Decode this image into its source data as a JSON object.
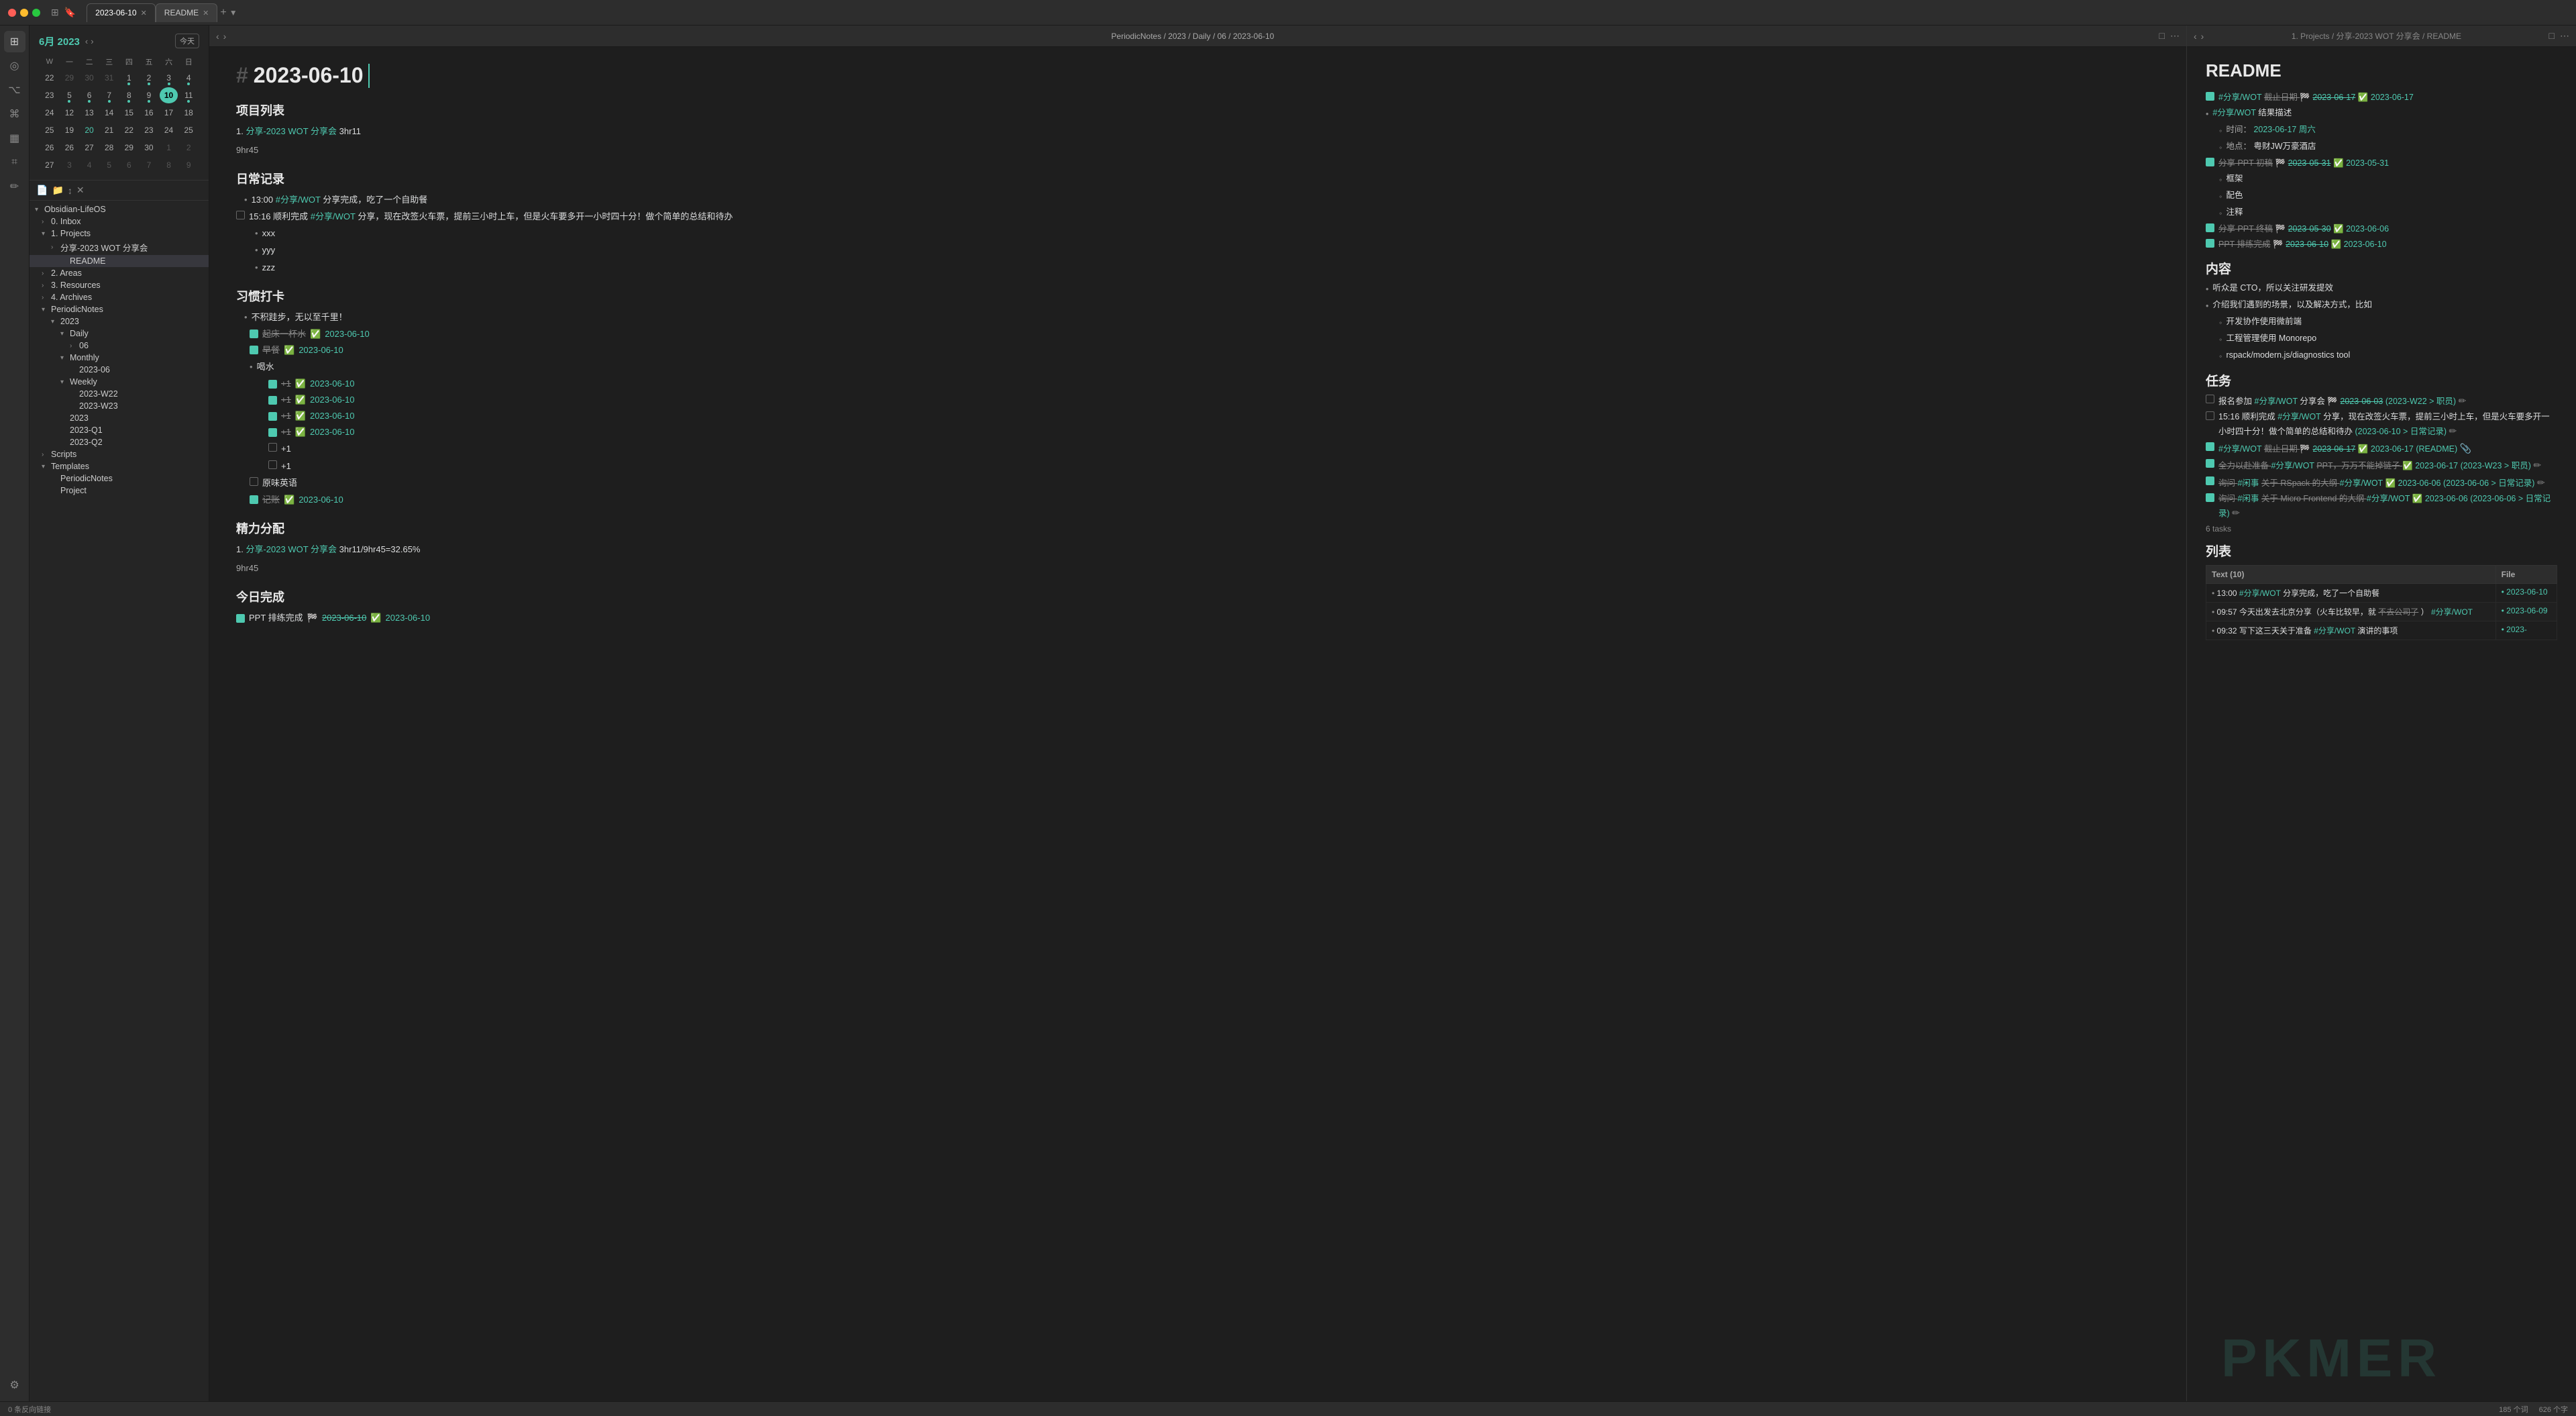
{
  "titlebar": {
    "tab1_label": "2023-06-10",
    "tab2_label": "README",
    "add_tab_label": "+",
    "tab1_active": true
  },
  "editor": {
    "breadcrumb": "PeriodicNotes / 2023 / Daily / 06 / 2023-06-10",
    "title_hash": "#",
    "title_text": "2023-06-10",
    "section1": "项目列表",
    "section2": "日常记录",
    "section3": "习惯打卡",
    "section4": "精力分配",
    "section5": "今日完成",
    "project_item1": "分享-2023 WOT 分享会",
    "project_time1": "3hr11",
    "project_subtotal": "9hr45",
    "daily_time1": "13:00",
    "daily_tag1": "#分享/WOT",
    "daily_text1": "分享完成，吃了一个自助餐",
    "daily_item2_prefix": "15:16 顺利完成",
    "daily_tag2": "#分享/WOT",
    "daily_text2": "分享，现在改签火车票，提前三小时上车，但是火车要多开一小时四十分！做个简单的总结和待办",
    "sub1": "xxx",
    "sub2": "yyy",
    "sub3": "zzz",
    "habit_intro": "不积跬步，无以至千里！",
    "habit1": "起床一杯水",
    "habit1_date": "2023-06-10",
    "habit2": "早餐",
    "habit2_date": "2023-06-10",
    "habit3": "喝水",
    "habit3_sub1_val": "+1",
    "habit3_sub1_date": "2023-06-10",
    "habit3_sub2_val": "+1",
    "habit3_sub2_date": "2023-06-10",
    "habit3_sub3_val": "+1",
    "habit3_sub3_date": "2023-06-10",
    "habit3_sub4_val": "+1",
    "habit3_sub4_date": "2023-06-10",
    "habit3_sub5_val": "+1",
    "habit3_sub6_val": "+1",
    "habit4": "原味英语",
    "habit5": "记账",
    "habit5_date": "2023-06-10",
    "energy_item1": "分享-2023 WOT 分享会",
    "energy_time1": "3hr11/9hr45=32.65%",
    "energy_subtotal": "9hr45",
    "done_item1": "PPT 排练完成",
    "done_date1": "2023-06-10",
    "done_date2": "2023-06-10"
  },
  "readme": {
    "breadcrumb": "1. Projects / 分享-2023 WOT 分享会 / README",
    "title": "README",
    "section_top_tag": "#分享/WOT",
    "section_top_strikethrough": "截止日期",
    "section_top_date1": "2023-06-17",
    "section_top_date2": "2023-06-17",
    "result_label": "#分享/WOT 结果描述",
    "time_label": "时间：",
    "time_val": "2023-06-17 周六",
    "place_label": "地点：",
    "place_val": "粤财JW万豪酒店",
    "ppt_draft": "分享 PPT 初稿",
    "ppt_draft_date1": "2023-05-31",
    "ppt_draft_date2": "2023-05-31",
    "ppt_sub1": "框架",
    "ppt_sub2": "配色",
    "ppt_sub3": "注释",
    "ppt_final": "分享 PPT 终稿",
    "ppt_final_date1": "2023-05-30",
    "ppt_final_date2": "2023-06-06",
    "ppt_done": "PPT 排练完成",
    "ppt_done_date1": "2023-06-10",
    "ppt_done_date2": "2023-06-10",
    "section_content": "内容",
    "content_item1": "听众是 CTO，所以关注研发提效",
    "content_item2": "介绍我们遇到的场景，以及解决方式，比如",
    "content_sub1": "开发协作使用微前端",
    "content_sub2": "工程管理使用 Monorepo",
    "content_sub3": "rspack/modern.js/diagnostics tool",
    "section_task": "任务",
    "task1_text": "报名参加",
    "task1_tag": "#分享/WOT",
    "task1_extra": "分享会",
    "task1_date": "2023-06-03",
    "task1_link": "2023-W22 > 职员",
    "task2_text": "15:16 顺利完成",
    "task2_tag": "#分享/WOT",
    "task2_body": "分享，现在改签火车票，提前三小时上车，但是火车要多开一小时四十分！做个简单的总结和待办",
    "task2_link": "2023-06-10 > 日常记录",
    "task3_tag": "#分享/WOT",
    "task3_text": "截止日期",
    "task3_date": "2023-06-17",
    "task3_link": "README",
    "task4_text": "全力以赴准备",
    "task4_tag": "#分享/WOT",
    "task4_body": "PPT，万万不能掉链子",
    "task4_date": "2023-06-17",
    "task4_link": "2023-W23 > 职员",
    "task5_text": "询问",
    "task5_tag": "#闲事",
    "task5_body": "关于 RSpack 的大纲",
    "task5_tag2": "#分享/WOT",
    "task5_date": "2023-06-06",
    "task5_link": "2023-06-06 > 日常记录",
    "task6_text": "询问",
    "task6_tag": "#闲事",
    "task6_body": "关于 Micro Frontend 的大纲",
    "task6_tag2": "#分享/WOT",
    "task6_date": "2023-06-06",
    "task6_link": "2023-06-06 > 日常记录",
    "task_count": "6 tasks",
    "section_list": "列表",
    "list_col1": "Text (10)",
    "list_col2": "File",
    "list_row1_text1": "13:00",
    "list_row1_tag1": "#分享/WOT",
    "list_row1_text2": "分享完成，吃了一个自助餐",
    "list_row1_file": "2023-06-10",
    "list_row2_text": "09:57 今天出发去北京分享（火车比较早，就不去公司了）",
    "list_row2_tag": "#分享/WOT",
    "list_row2_file": "2023-06-09",
    "list_row3_text": "09:32 写下这三天关于准备",
    "list_row3_tag": "#分享/WOT",
    "list_row3_extra": "演讲的事项",
    "list_row3_file": "2023-",
    "statusbar_left": "0 条反向链接",
    "statusbar_right1": "185 个词",
    "statusbar_right2": "626 个字"
  },
  "sidebar": {
    "filetree_items": [
      {
        "label": "Obsidian-LifeOS",
        "level": 0,
        "type": "root",
        "expanded": true
      },
      {
        "label": "0. Inbox",
        "level": 1,
        "type": "folder",
        "expanded": false
      },
      {
        "label": "1. Projects",
        "level": 1,
        "type": "folder",
        "expanded": true
      },
      {
        "label": "分享-2023 WOT 分享会",
        "level": 2,
        "type": "folder",
        "expanded": false
      },
      {
        "label": "README",
        "level": 3,
        "type": "file",
        "selected": true
      },
      {
        "label": "2. Areas",
        "level": 1,
        "type": "folder",
        "expanded": false
      },
      {
        "label": "3. Resources",
        "level": 1,
        "type": "folder",
        "expanded": false
      },
      {
        "label": "4. Archives",
        "level": 1,
        "type": "folder",
        "expanded": false
      },
      {
        "label": "PeriodicNotes",
        "level": 1,
        "type": "folder",
        "expanded": true
      },
      {
        "label": "2023",
        "level": 2,
        "type": "folder",
        "expanded": true
      },
      {
        "label": "Daily",
        "level": 3,
        "type": "folder",
        "expanded": true
      },
      {
        "label": "06",
        "level": 4,
        "type": "folder",
        "expanded": false
      },
      {
        "label": "Monthly",
        "level": 3,
        "type": "folder",
        "expanded": true
      },
      {
        "label": "2023-06",
        "level": 4,
        "type": "file"
      },
      {
        "label": "Weekly",
        "level": 3,
        "type": "folder",
        "expanded": true
      },
      {
        "label": "2023-W22",
        "level": 4,
        "type": "file"
      },
      {
        "label": "2023-W23",
        "level": 4,
        "type": "file"
      },
      {
        "label": "2023",
        "level": 3,
        "type": "file"
      },
      {
        "label": "2023-Q1",
        "level": 3,
        "type": "file"
      },
      {
        "label": "2023-Q2",
        "level": 3,
        "type": "file"
      },
      {
        "label": "Scripts",
        "level": 1,
        "type": "folder",
        "expanded": false
      },
      {
        "label": "Templates",
        "level": 1,
        "type": "folder",
        "expanded": true
      },
      {
        "label": "PeriodicNotes",
        "level": 2,
        "type": "file"
      },
      {
        "label": "Project",
        "level": 2,
        "type": "file"
      }
    ]
  },
  "calendar": {
    "month": "6月",
    "year": "2023",
    "today_btn": "今天",
    "headers": [
      "W",
      "一",
      "二",
      "三",
      "四",
      "五",
      "六",
      "日"
    ],
    "weeks": [
      {
        "week": "22",
        "days": [
          {
            "n": "29",
            "m": true
          },
          {
            "n": "30",
            "m": true
          },
          {
            "n": "31",
            "m": true
          },
          {
            "n": "1",
            "dot": true
          },
          {
            "n": "2",
            "dot": true
          },
          {
            "n": "3",
            "dot": true
          },
          {
            "n": "4",
            "dot": true
          }
        ]
      },
      {
        "week": "23",
        "days": [
          {
            "n": "5",
            "dot": true
          },
          {
            "n": "6",
            "dot": true
          },
          {
            "n": "7",
            "dot": true
          },
          {
            "n": "8",
            "dot": true
          },
          {
            "n": "9",
            "dot": true
          },
          {
            "n": "10",
            "today": true
          },
          {
            "n": "11",
            "dot": true
          }
        ]
      },
      {
        "week": "24",
        "days": [
          {
            "n": "12"
          },
          {
            "n": "13"
          },
          {
            "n": "14"
          },
          {
            "n": "15"
          },
          {
            "n": "16"
          },
          {
            "n": "17"
          },
          {
            "n": "18"
          }
        ]
      },
      {
        "week": "25",
        "days": [
          {
            "n": "19"
          },
          {
            "n": "20",
            "green": true
          },
          {
            "n": "21"
          },
          {
            "n": "22"
          },
          {
            "n": "23"
          },
          {
            "n": "24"
          },
          {
            "n": "25"
          }
        ]
      },
      {
        "week": "26",
        "days": [
          {
            "n": "26"
          },
          {
            "n": "27"
          },
          {
            "n": "28"
          },
          {
            "n": "29"
          },
          {
            "n": "30"
          },
          {
            "n": "1",
            "m": true
          },
          {
            "n": "2",
            "m": true
          }
        ]
      },
      {
        "week": "27",
        "days": [
          {
            "n": "3",
            "m": true
          },
          {
            "n": "4",
            "m": true
          },
          {
            "n": "5",
            "m": true
          },
          {
            "n": "6",
            "m": true
          },
          {
            "n": "7",
            "m": true
          },
          {
            "n": "8",
            "m": true
          },
          {
            "n": "9",
            "m": true
          }
        ]
      }
    ]
  }
}
